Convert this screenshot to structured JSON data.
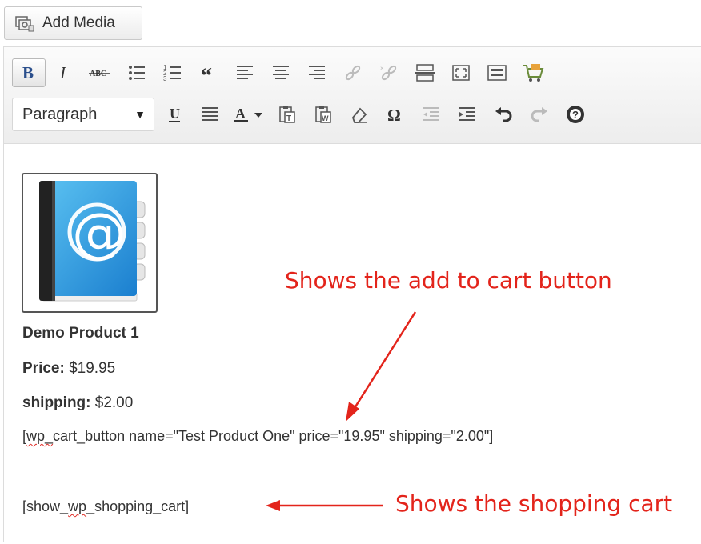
{
  "add_media": {
    "label": "Add Media"
  },
  "toolbar": {
    "row1": [
      "bold-icon",
      "italic-icon",
      "strikethrough-icon",
      "bullet-list-icon",
      "numbered-list-icon",
      "blockquote-icon",
      "align-left-icon",
      "align-center-icon",
      "align-right-icon",
      "insert-link-icon",
      "remove-link-icon",
      "read-more-icon",
      "fullscreen-icon",
      "kitchen-sink-icon",
      "shopping-cart-icon"
    ],
    "format_select": {
      "value": "Paragraph"
    },
    "row2": [
      "underline-icon",
      "justify-icon",
      "text-color-icon",
      "paste-text-icon",
      "paste-word-icon",
      "clear-formatting-icon",
      "special-character-icon",
      "outdent-icon",
      "indent-icon",
      "undo-icon",
      "redo-icon",
      "help-icon"
    ]
  },
  "content": {
    "product_title": "Demo Product 1",
    "price_label": "Price:",
    "price_value": " $19.95",
    "shipping_label": "shipping:",
    "shipping_value": " $2.00",
    "shortcode_button_prefix": "[",
    "shortcode_button_squiggle": "wp_",
    "shortcode_button_rest": "cart_button name=\"Test Product One\" price=\"19.95\" shipping=\"2.00\"]",
    "shortcode_cart_prefix": "[show_",
    "shortcode_cart_squiggle": "wp",
    "shortcode_cart_rest": "_shopping_cart]"
  },
  "annotations": {
    "add_to_cart": "Shows the add to cart button",
    "shopping_cart": "Shows the shopping cart",
    "color": "#e3241b"
  }
}
